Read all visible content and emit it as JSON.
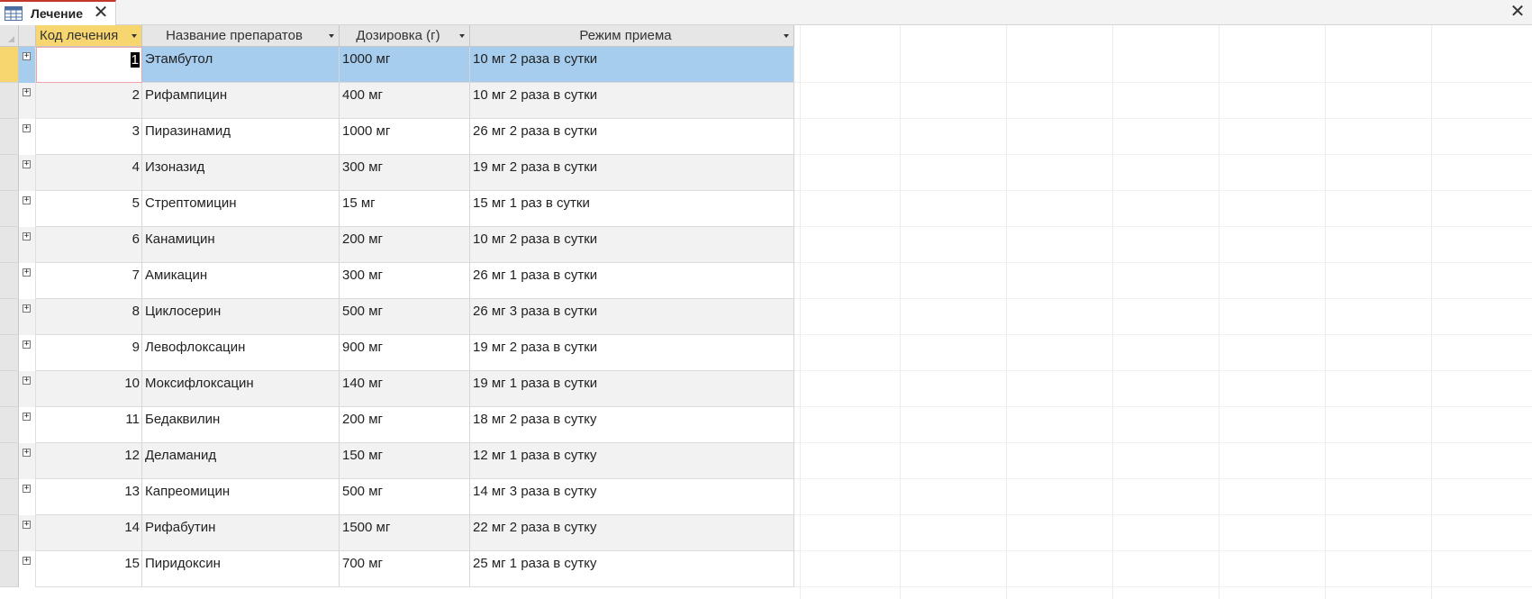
{
  "tab": {
    "title": "Лечение",
    "close_glyph": "✕",
    "icon": "table-icon"
  },
  "window": {
    "close_glyph": "✕"
  },
  "columns": [
    "Код лечения",
    "Название препаратов",
    "Дозировка (г)",
    "Режим приема"
  ],
  "rows": [
    {
      "id": "1",
      "name": "Этамбутол",
      "dose": "1000 мг",
      "regimen": "10 мг 2 раза в сутки"
    },
    {
      "id": "2",
      "name": "Рифампицин",
      "dose": "400 мг",
      "regimen": "10 мг 2 раза в сутки"
    },
    {
      "id": "3",
      "name": "Пиразинамид",
      "dose": "1000 мг",
      "regimen": "26 мг 2 раза в сутки"
    },
    {
      "id": "4",
      "name": "Изоназид",
      "dose": "300 мг",
      "regimen": "19 мг 2 раза в сутки"
    },
    {
      "id": "5",
      "name": "Стрептомицин",
      "dose": "15 мг",
      "regimen": "15 мг 1 раз в сутки"
    },
    {
      "id": "6",
      "name": "Канамицин",
      "dose": "200 мг",
      "regimen": "10 мг 2 раза в сутки"
    },
    {
      "id": "7",
      "name": "Амикацин",
      "dose": "300 мг",
      "regimen": "26 мг 1 раза в сутки"
    },
    {
      "id": "8",
      "name": "Циклосерин",
      "dose": "500 мг",
      "regimen": "26 мг 3 раза в сутки"
    },
    {
      "id": "9",
      "name": "Левофлоксацин",
      "dose": "900 мг",
      "regimen": "19 мг 2 раза в сутки"
    },
    {
      "id": "10",
      "name": "Моксифлоксацин",
      "dose": "140 мг",
      "regimen": "19 мг 1 раза в сутки"
    },
    {
      "id": "11",
      "name": "Бедаквилин",
      "dose": "200 мг",
      "regimen": "18 мг 2 раза в сутку"
    },
    {
      "id": "12",
      "name": "Деламанид",
      "dose": "150 мг",
      "regimen": "12 мг 1 раза в сутку"
    },
    {
      "id": "13",
      "name": "Капреомицин",
      "dose": "500 мг",
      "regimen": "14 мг 3 раза в сутку"
    },
    {
      "id": "14",
      "name": "Рифабутин",
      "dose": "1500 мг",
      "regimen": "22 мг 2 раза в сутку"
    },
    {
      "id": "15",
      "name": "Пиридоксин",
      "dose": "700 мг",
      "regimen": "25 мг 1 раза в сутку"
    }
  ],
  "selected_row": 0,
  "colors": {
    "selection": "#a6cdee",
    "active_header": "#f8d66f",
    "tab_accent": "#c0392b"
  }
}
